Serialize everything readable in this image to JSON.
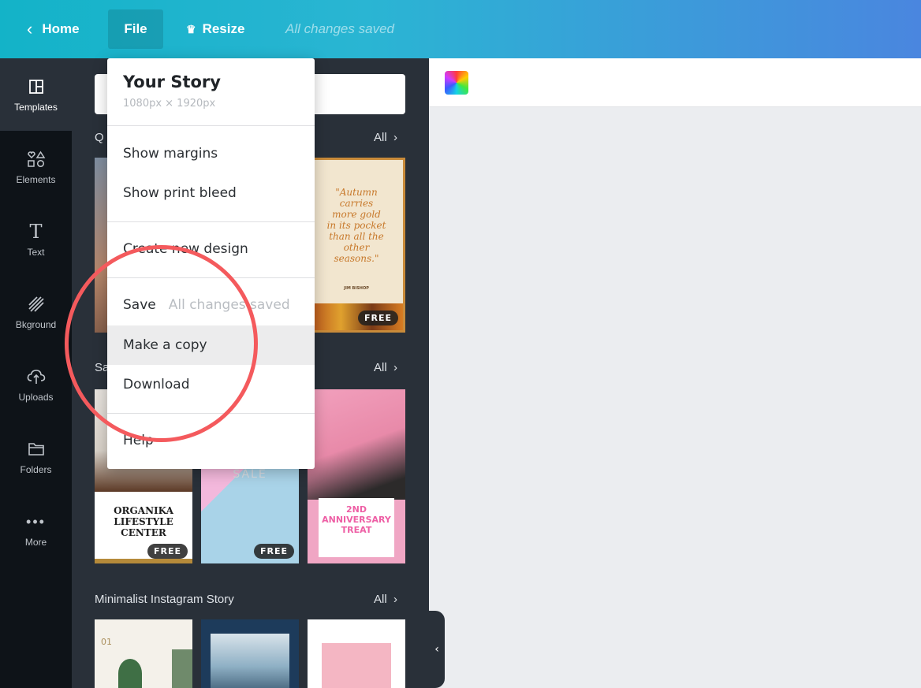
{
  "topbar": {
    "home_label": "Home",
    "file_label": "File",
    "resize_label": "Resize",
    "saved_status": "All changes saved"
  },
  "rail": {
    "items": [
      {
        "label": "Templates",
        "icon": "templates-icon"
      },
      {
        "label": "Elements",
        "icon": "elements-icon"
      },
      {
        "label": "Text",
        "icon": "text-icon"
      },
      {
        "label": "Bkground",
        "icon": "background-icon"
      },
      {
        "label": "Uploads",
        "icon": "upload-cloud-icon"
      },
      {
        "label": "Folders",
        "icon": "folder-icon"
      },
      {
        "label": "More",
        "icon": "more-dots-icon"
      }
    ]
  },
  "panel": {
    "sections": [
      {
        "title": "Q",
        "all_label": "All"
      },
      {
        "title": "Sa",
        "all_label": "All"
      },
      {
        "title": "Minimalist Instagram Story",
        "all_label": "All"
      }
    ],
    "templates": {
      "quote_lines": [
        "\"Autumn",
        "carries",
        "more gold",
        "in its pocket",
        "than all the",
        "other",
        "seasons.\""
      ],
      "quote_author": "JIM BISHOP",
      "organika": [
        "ORGANIKA",
        "LIFESTYLE",
        "CENTER"
      ],
      "sale": "SALE",
      "anniversary": [
        "2ND",
        "ANNIVERSARY",
        "TREAT"
      ],
      "minimal_number": "01",
      "free_badge": "FREE"
    }
  },
  "menu": {
    "title": "Your Story",
    "subtitle": "1080px × 1920px",
    "items": {
      "show_margins": "Show margins",
      "show_print_bleed": "Show print bleed",
      "create_new_design": "Create new design",
      "save": "Save",
      "save_note": "All changes saved",
      "make_copy": "Make a copy",
      "download": "Download",
      "help": "Help"
    }
  },
  "colors": {
    "topbar_start": "#13b3c8",
    "topbar_end": "#4a86df",
    "rail_bg": "#0e1318",
    "panel_bg": "#293039",
    "annotation_circle": "#f45a5d"
  }
}
